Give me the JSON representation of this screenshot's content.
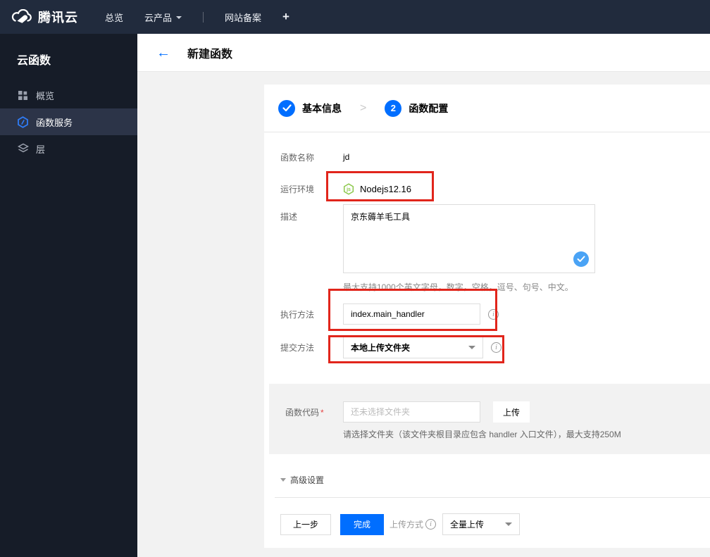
{
  "topbar": {
    "brand": "腾讯云",
    "nav_overview": "总览",
    "nav_products": "云产品",
    "nav_icp": "网站备案",
    "nav_plus": "+"
  },
  "sidebar": {
    "title": "云函数",
    "items": [
      {
        "label": "概览",
        "icon": "grid-icon",
        "active": false
      },
      {
        "label": "函数服务",
        "icon": "function-hexagon-icon",
        "active": true
      },
      {
        "label": "层",
        "icon": "layers-icon",
        "active": false
      }
    ]
  },
  "header": {
    "title": "新建函数",
    "back_icon": "←"
  },
  "steps": [
    {
      "number": "1",
      "label": "基本信息",
      "state": "done"
    },
    {
      "number": "2",
      "label": "函数配置",
      "state": "current"
    }
  ],
  "form": {
    "name": {
      "label": "函数名称",
      "value": "jd"
    },
    "runtime": {
      "label": "运行环境",
      "value": "Nodejs12.16",
      "icon": "nodejs-icon"
    },
    "description": {
      "label": "描述",
      "value": "京东薅羊毛工具",
      "helper": "最大支持1000个英文字母，数字，空格，逗号、句号、中文。"
    },
    "handler": {
      "label": "执行方法",
      "value": "index.main_handler"
    },
    "submit_method": {
      "label": "提交方法",
      "value": "本地上传文件夹"
    },
    "code": {
      "label": "函数代码",
      "required_mark": "*",
      "placeholder": "还未选择文件夹",
      "upload_button": "上传",
      "helper": "请选择文件夹（该文件夹根目录应包含 handler 入口文件），最大支持250M"
    },
    "advanced_label": "高级设置"
  },
  "footer": {
    "prev_button": "上一步",
    "finish_button": "完成",
    "upload_mode_label": "上传方式",
    "upload_mode_value": "全量上传"
  },
  "colors": {
    "accent_blue": "#006eff",
    "light_check_blue": "#4aa3f5",
    "annotation_red": "#e1251b",
    "nodejs_green": "#8cc84b",
    "topbar_bg": "#212b3d",
    "sidebar_bg": "#161c28",
    "sidebar_active_bg": "#2c3448"
  }
}
